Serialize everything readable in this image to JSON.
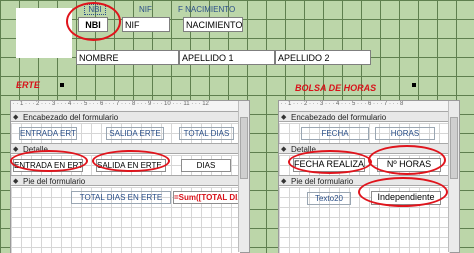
{
  "main_form": {
    "labels": {
      "nbi": "NBI",
      "nif": "NIF",
      "f_nacimiento": "F NACIMIENTO"
    },
    "fields": {
      "nbi": "NBI",
      "nif": "NIF",
      "nacimiento": "NACIMIENTO",
      "nombre": "NOMBRE",
      "apellido1": "APELLIDO 1",
      "apellido2": "APELLIDO 2"
    }
  },
  "subform_left": {
    "title": "ERTE",
    "sections": {
      "header": "Encabezado del formulario",
      "detail": "Detalle",
      "footer": "Pie del formulario"
    },
    "header_labels": [
      "ENTRADA ERTE",
      "SALIDA ERTE",
      "TOTAL DIAS"
    ],
    "detail_fields": [
      "ENTRADA EN ERTE",
      "SALIDA EN ERTE",
      "DIAS"
    ],
    "footer_label": "TOTAL DIAS EN ERTE",
    "footer_field": "=Sum([TOTAL DIAS])"
  },
  "subform_right": {
    "title": "BOLSA DE HORAS",
    "sections": {
      "header": "Encabezado del formulario",
      "detail": "Detalle",
      "footer": "Pie del formulario"
    },
    "header_labels": [
      "FECHA",
      "HORAS"
    ],
    "detail_fields": [
      "FECHA REALIZADA",
      "Nº HORAS"
    ],
    "footer_label": "Texto20",
    "footer_field": "Independiente"
  },
  "colors": {
    "grid_bg": "#bcd6a9",
    "annotation_red": "#e0141c",
    "label_blue": "#2a4f88"
  }
}
